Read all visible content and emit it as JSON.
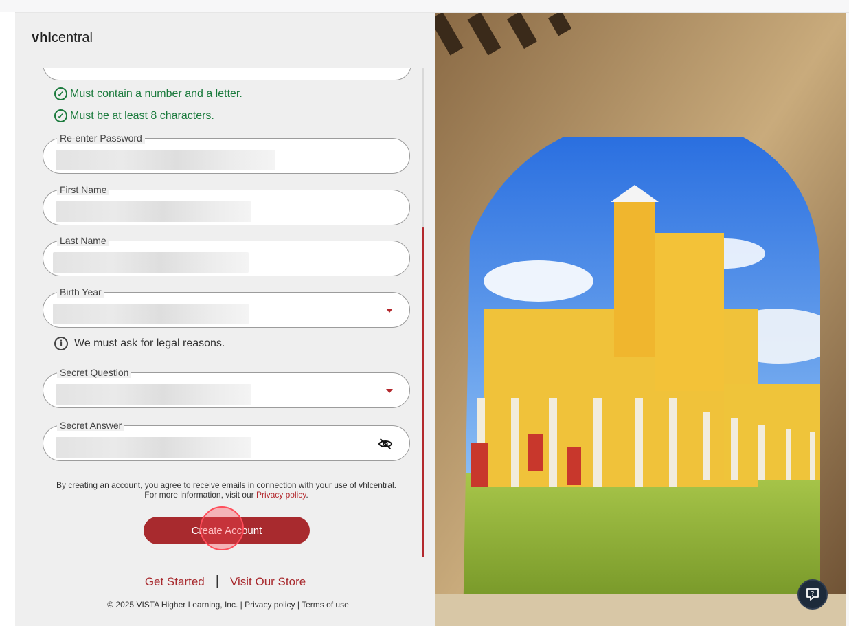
{
  "brand": {
    "logo_bold": "vhl",
    "logo_rest": "central"
  },
  "password_rules": [
    {
      "text": "Must contain a number and a letter.",
      "status": "met"
    },
    {
      "text": "Must be at least 8 characters.",
      "status": "met"
    }
  ],
  "fields": {
    "reenter_password": {
      "label": "Re-enter Password"
    },
    "first_name": {
      "label": "First Name"
    },
    "last_name": {
      "label": "Last Name"
    },
    "birth_year": {
      "label": "Birth Year"
    },
    "secret_question": {
      "label": "Secret Question"
    },
    "secret_answer": {
      "label": "Secret Answer"
    }
  },
  "info_note": "We must ask for legal reasons.",
  "legal": {
    "line1": "By creating an account, you agree to receive emails in connection with your use of vhlcentral.",
    "line2_prefix": "For more information, visit our ",
    "privacy_link": "Privacy policy",
    "line2_suffix": "."
  },
  "create_button_label": "Create Account",
  "footer": {
    "get_started": "Get Started",
    "separator": "|",
    "visit_store": "Visit Our Store",
    "copyright": "© 2025 VISTA Higher Learning, Inc.",
    "privacy": "Privacy policy",
    "terms": "Terms of use",
    "divider": "|"
  },
  "colors": {
    "accent": "#a82a2e",
    "success": "#1a7a3c",
    "panel_bg": "#efefef"
  },
  "icons": {
    "rule_status": "check-circle-icon",
    "info": "info-icon",
    "eye": "eye-off-icon",
    "dropdown": "caret-down-icon",
    "help": "help-icon"
  }
}
